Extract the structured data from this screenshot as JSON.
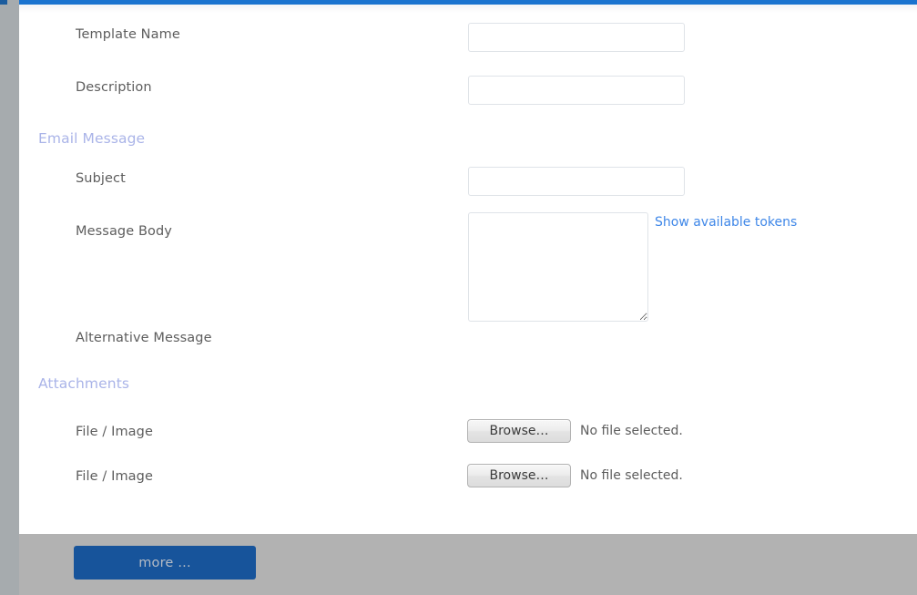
{
  "accent_colors": {
    "top_bar_blue": "#1a73cf",
    "section_header_blue": "#aab4e8",
    "link_blue": "#3f87e8",
    "primary_button_blue": "#17549b",
    "footer_gray": "#b2b2b2",
    "gutter_gray": "#a6abae"
  },
  "form": {
    "rows": [
      {
        "type": "text",
        "label": "Template Name",
        "value": "",
        "placeholder": ""
      },
      {
        "type": "text",
        "label": "Description",
        "value": "",
        "placeholder": ""
      },
      {
        "type": "section",
        "label": "Email Message"
      },
      {
        "type": "text",
        "label": "Subject",
        "value": "",
        "placeholder": ""
      },
      {
        "type": "textarea",
        "label": "Message Body",
        "value": "",
        "placeholder": "",
        "link_label": "Show available tokens"
      },
      {
        "type": "label-only",
        "label": "Alternative Message"
      },
      {
        "type": "section",
        "label": "Attachments"
      },
      {
        "type": "file",
        "label": "File / Image",
        "button_label": "Browse…",
        "status": "No file selected."
      },
      {
        "type": "file",
        "label": "File / Image",
        "button_label": "Browse…",
        "status": "No file selected."
      }
    ]
  },
  "footer": {
    "more_button_label": "more ..."
  }
}
